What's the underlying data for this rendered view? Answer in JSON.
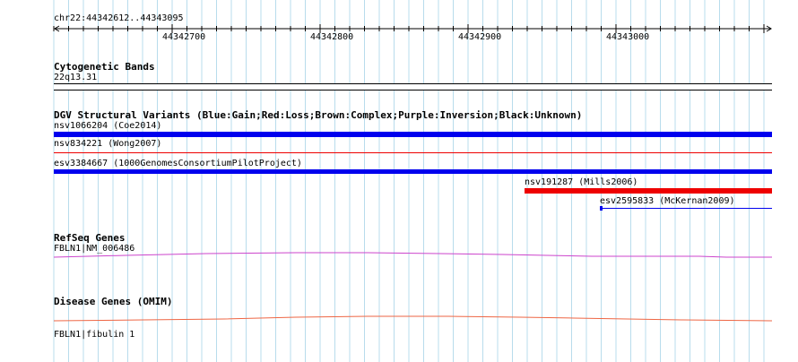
{
  "ruler": {
    "location": "chr22:44342612..44343095",
    "ticks": [
      "44342700",
      "44342800",
      "44342900",
      "44343000"
    ]
  },
  "cytoband": {
    "title": "Cytogenetic Bands",
    "band": "22q13.31"
  },
  "dgv": {
    "title": "DGV Structural Variants (Blue:Gain;Red:Loss;Brown:Complex;Purple:Inversion;Black:Unknown)",
    "variants": [
      {
        "label": "nsv1066204 (Coe2014)",
        "type": "Gain",
        "color": "#0000ee"
      },
      {
        "label": "nsv834221 (Wong2007)",
        "type": "Loss",
        "color": "#ee0000"
      },
      {
        "label": "esv3384667 (1000GenomesConsortiumPilotProject)",
        "type": "Gain",
        "color": "#0000ee"
      },
      {
        "label": "nsv191287 (Mills2006)",
        "type": "Loss",
        "color": "#ee0000"
      },
      {
        "label": "esv2595833 (McKernan2009)",
        "type": "Gain",
        "color": "#0000ee"
      }
    ]
  },
  "refseq": {
    "title": "RefSeq Genes",
    "gene": "FBLN1|NM_006486",
    "color": "#cc44cc"
  },
  "omim": {
    "title": "Disease Genes (OMIM)",
    "gene": "FBLN1|fibulin 1",
    "color": "#ee6644"
  },
  "colors": {
    "grid": "#b8dcec",
    "blue": "#0000ee",
    "red": "#ee0000"
  }
}
